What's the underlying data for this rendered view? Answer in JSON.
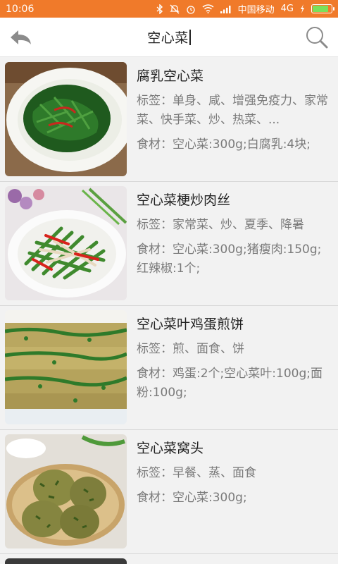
{
  "status_bar": {
    "time": "10:06",
    "carrier": "中国移动",
    "network": "4G",
    "battery_level": 0.85,
    "icons": [
      "bluetooth-icon",
      "mute-icon",
      "alarm-icon",
      "wifi-icon",
      "signal-icon",
      "charging-icon",
      "battery-icon"
    ]
  },
  "header": {
    "title": "空心菜",
    "back_icon": "back-arrow-icon",
    "search_icon": "search-icon"
  },
  "colors": {
    "accent": "#f07a2a",
    "background": "#f2f2f2",
    "title_text": "#222222",
    "meta_text": "#7a7a7a"
  },
  "recipes": [
    {
      "name": "腐乳空心菜",
      "tags": "标签：单身、咸、增强免疫力、家常菜、快手菜、炒、热菜、...",
      "ingredients": "食材：空心菜:300g;白腐乳:4块;"
    },
    {
      "name": "空心菜梗炒肉丝",
      "tags": "标签：家常菜、炒、夏季、降暑",
      "ingredients": "食材：空心菜:300g;猪瘦肉:150g;红辣椒:1个;"
    },
    {
      "name": "空心菜叶鸡蛋煎饼",
      "tags": "标签：煎、面食、饼",
      "ingredients": "食材：鸡蛋:2个;空心菜叶:100g;面粉:100g;"
    },
    {
      "name": "空心菜窝头",
      "tags": "标签：早餐、蒸、面食",
      "ingredients": "食材：空心菜:300g;"
    }
  ]
}
